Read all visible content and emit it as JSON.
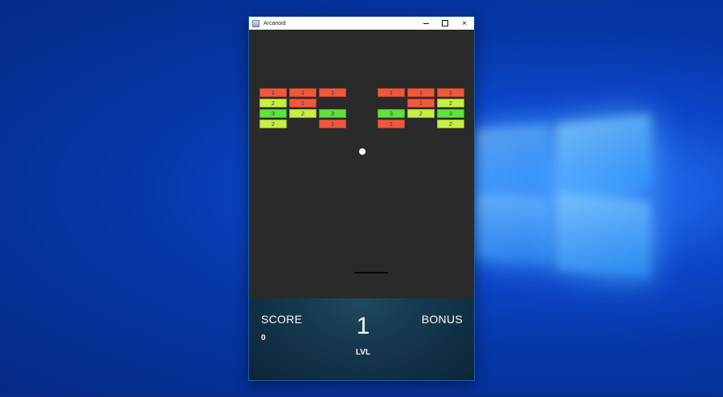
{
  "window": {
    "title": "Arcanoid",
    "icon": "app-window-icon",
    "controls": {
      "minimize": "minimize-icon",
      "maximize": "maximize-icon",
      "close": "×"
    }
  },
  "colors": {
    "brick_1": "#f0583c",
    "brick_2": "#c6ef42",
    "brick_3": "#5fe33a",
    "game_bg": "#2a2a2a",
    "hud_bg": "#16384e"
  },
  "bricks": {
    "left": [
      [
        "1",
        "1",
        "1"
      ],
      [
        "2",
        "1",
        ""
      ],
      [
        "3",
        "2",
        "3"
      ],
      [
        "2",
        "",
        "1"
      ]
    ],
    "right": [
      [
        "1",
        "1",
        "1"
      ],
      [
        "",
        "1",
        "2"
      ],
      [
        "3",
        "2",
        "3"
      ],
      [
        "1",
        "",
        "2"
      ]
    ]
  },
  "hud": {
    "score_label": "SCORE",
    "score_value": "0",
    "level_value": "1",
    "level_label": "LVL",
    "bonus_label": "BONUS"
  }
}
